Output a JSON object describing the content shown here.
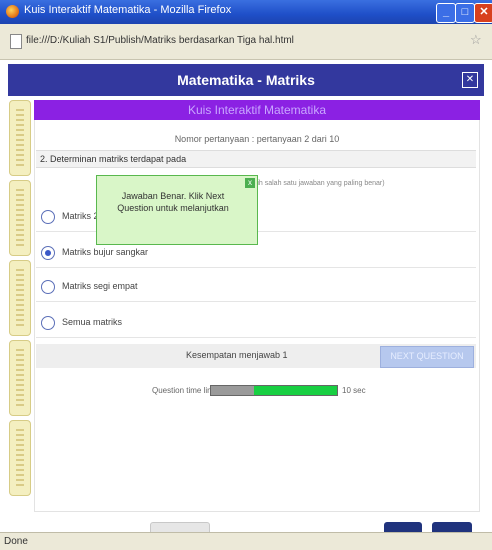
{
  "window": {
    "title": "Kuis Interaktif Matematika - Mozilla Firefox",
    "url": "file:///D:/Kuliah S1/Publish/Matriks berdasarkan Tiga hal.html"
  },
  "app": {
    "title": "Matematika - Matriks"
  },
  "quiz": {
    "banner": "Kuis Interaktif Matematika",
    "counter": "Nomor pertanyaan : pertanyaan 2 dari 10",
    "question": "2. Determinan matriks terdapat pada",
    "hint": "(pilih salah satu jawaban yang paling benar)",
    "options": [
      {
        "label": "Matriks 2x3",
        "checked": false
      },
      {
        "label": "Matriks bujur sangkar",
        "checked": true
      },
      {
        "label": "Matriks segi empat",
        "checked": false
      },
      {
        "label": "Semua matriks",
        "checked": false
      }
    ],
    "tooltip": "Jawaban Benar. Klik Next Question untuk melanjutkan",
    "attempts": "Kesempatan menjawab 1",
    "next_label": "NEXT QUESTION",
    "timer_label": "Question time limit",
    "timer_seconds": "10 sec",
    "timer_fraction": 0.66
  },
  "status": {
    "text": "Done"
  },
  "icons": {
    "app": "firefox-icon",
    "page": "page-icon",
    "bookmark": "star-icon"
  }
}
